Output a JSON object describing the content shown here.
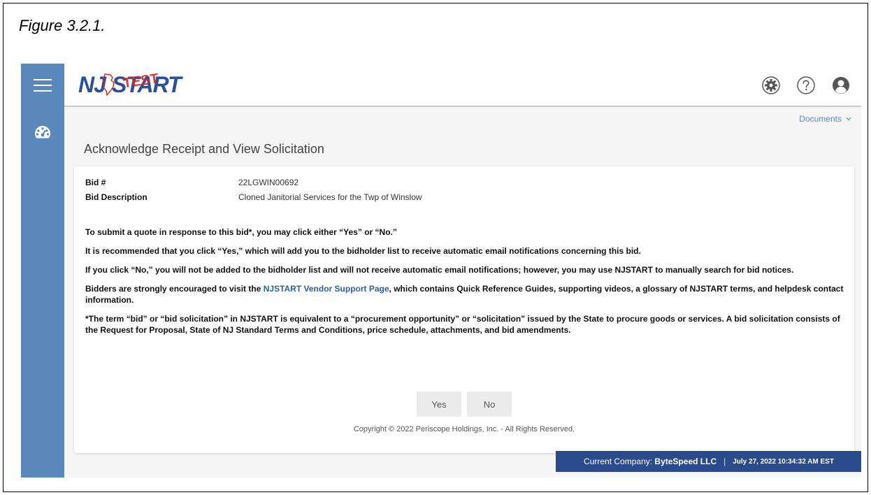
{
  "figure_caption": "Figure 3.2.1.",
  "header": {
    "logo_nj": "NJ",
    "logo_start": "START",
    "logo_test": "TEST",
    "icons": [
      "gear-icon",
      "help-icon",
      "user-icon"
    ]
  },
  "sidebar": {
    "icons": [
      "menu-icon",
      "dashboard-icon"
    ]
  },
  "documents_link": "Documents",
  "page_title": "Acknowledge Receipt and View Solicitation",
  "bid": {
    "number_label": "Bid #",
    "number_value": "22LGWIN00692",
    "description_label": "Bid Description",
    "description_value": "Cloned Janitorial Services for the Twp of Winslow"
  },
  "messages": {
    "p1": "To submit a quote in response to this bid*, you may click either “Yes” or “No.”",
    "p2": "It is recommended that you click “Yes,” which will add you to the bidholder list to receive automatic email notifications concerning this bid.",
    "p3": "If you click “No,” you will not be added to the bidholder list and will not receive automatic email notifications; however, you may use NJSTART to manually search for bid notices.",
    "p4_before": "Bidders are strongly encouraged to visit the ",
    "p4_link": "NJSTART Vendor Support Page",
    "p4_after": ", which contains Quick Reference Guides, supporting videos, a glossary of NJSTART terms, and helpdesk contact information.",
    "p5": "*The term “bid” or “bid solicitation” in NJSTART is equivalent to a “procurement opportunity” or “solicitation” issued by the State to procure goods or services. A bid solicitation consists of the Request for Proposal, State of NJ Standard Terms and Conditions, price schedule, attachments, and bid amendments."
  },
  "buttons": {
    "yes": "Yes",
    "no": "No"
  },
  "copyright": "Copyright © 2022 Periscope Holdings, Inc. - All Rights Reserved.",
  "status_bar": {
    "company_label": "Current Company:",
    "company_name": "ByteSpeed LLC",
    "separator": "|",
    "datetime": "July 27, 2022 10:34:32 AM EST"
  },
  "colors": {
    "sidebar": "#5a87bd",
    "brand_blue": "#2c4f9a",
    "status_bar": "#2b4a8c",
    "test_red": "#d62828"
  }
}
